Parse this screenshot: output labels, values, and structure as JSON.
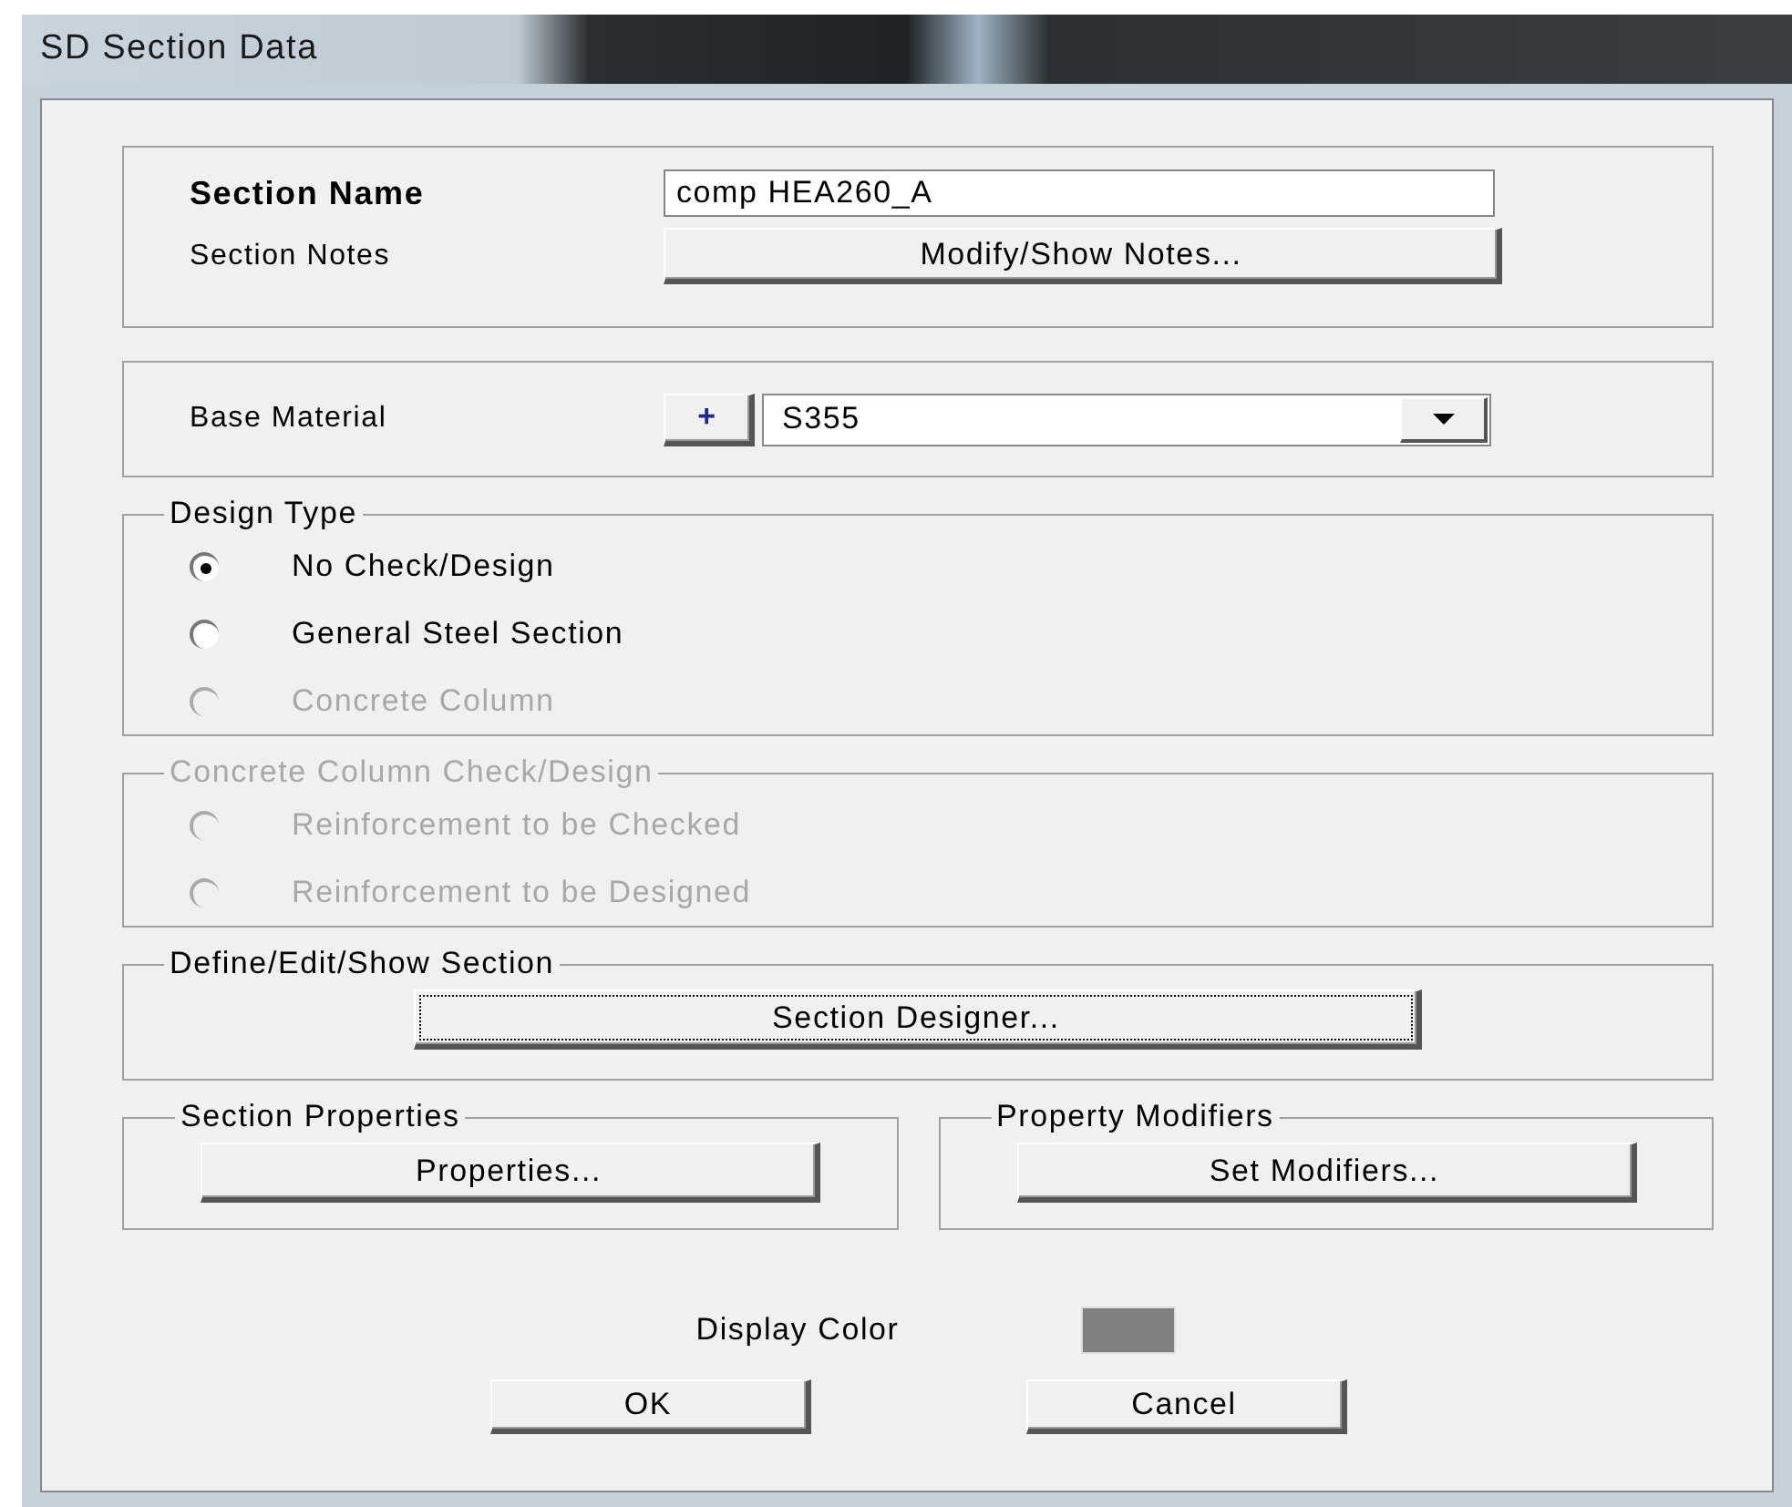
{
  "window": {
    "title": "SD Section Data"
  },
  "section_name": {
    "label": "Section Name",
    "value": "comp HEA260_A"
  },
  "section_notes": {
    "label": "Section Notes",
    "button": "Modify/Show Notes..."
  },
  "base_material": {
    "label": "Base Material",
    "add_button": "+",
    "value": "S355"
  },
  "design_type": {
    "title": "Design Type",
    "disabled": false,
    "options": [
      {
        "label": "No Check/Design",
        "selected": true,
        "disabled": false
      },
      {
        "label": "General Steel Section",
        "selected": false,
        "disabled": false
      },
      {
        "label": "Concrete Column",
        "selected": false,
        "disabled": true
      }
    ]
  },
  "concrete_column": {
    "title": "Concrete Column Check/Design",
    "disabled": true,
    "options": [
      {
        "label": "Reinforcement to be Checked",
        "selected": false,
        "disabled": true
      },
      {
        "label": "Reinforcement to be Designed",
        "selected": false,
        "disabled": true
      }
    ]
  },
  "define_section": {
    "title": "Define/Edit/Show Section",
    "button": "Section Designer..."
  },
  "section_properties": {
    "title": "Section Properties",
    "button": "Properties..."
  },
  "property_modifiers": {
    "title": "Property Modifiers",
    "button": "Set Modifiers..."
  },
  "display_color": {
    "label": "Display Color"
  },
  "buttons": [
    "OK",
    "Cancel"
  ]
}
